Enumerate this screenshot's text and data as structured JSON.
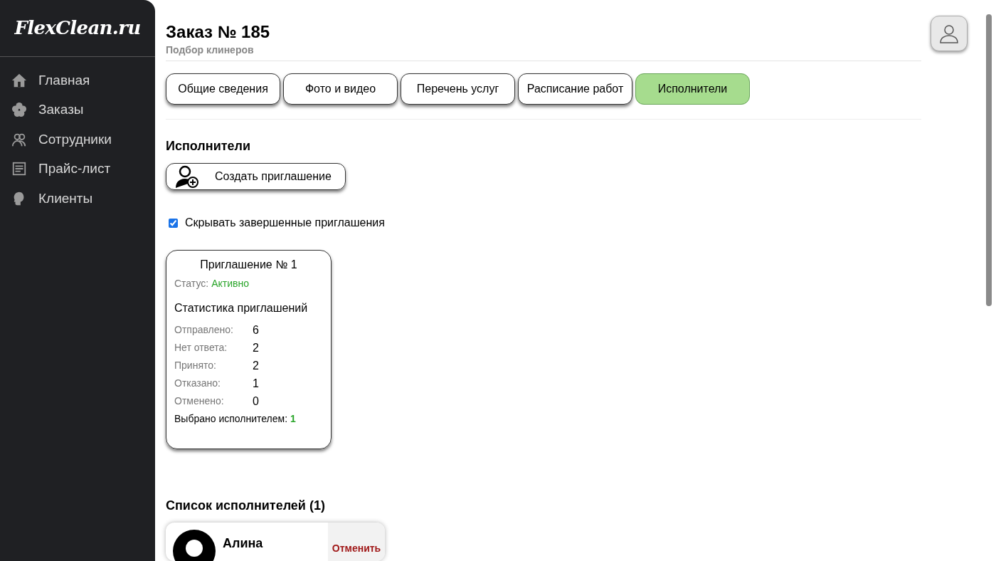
{
  "sidebar": {
    "logo": "FlexClean.ru",
    "items": [
      {
        "kind": "home",
        "label": "Главная",
        "selected": false
      },
      {
        "kind": "orders",
        "label": "Заказы",
        "selected": false
      },
      {
        "kind": "staff",
        "label": "Сотрудники",
        "selected": false
      },
      {
        "kind": "prices",
        "label": "Прайс-лист",
        "selected": false
      },
      {
        "kind": "clients",
        "label": "Клиенты",
        "selected": false
      }
    ]
  },
  "header": {
    "title": "Заказ № 185",
    "subtitle": "Подбор клинеров"
  },
  "tabs": [
    {
      "label": "Общие сведения",
      "selected": false
    },
    {
      "label": "Фото и видео",
      "selected": false
    },
    {
      "label": "Перечень услуг",
      "selected": false
    },
    {
      "label": "Расписание работ",
      "selected": false
    },
    {
      "label": "Исполнители",
      "selected": true
    }
  ],
  "section_title": "Исполнители",
  "create_button": "Создать приглашение",
  "hide_completed": {
    "label": "Скрывать завершенные приглашения",
    "checked": true
  },
  "invitation": {
    "title": "Приглашение № 1",
    "status_label": "Статус:",
    "status": "Активно",
    "stats_title": "Статистика приглашений",
    "stats": [
      {
        "label": "Отправлено:",
        "value": "6"
      },
      {
        "label": "Нет ответа:",
        "value": "2"
      },
      {
        "label": "Принято:",
        "value": "2"
      },
      {
        "label": "Отказано:",
        "value": "1"
      },
      {
        "label": "Отменено:",
        "value": "0"
      }
    ],
    "selected_label": "Выбрано исполнителем:",
    "selected_value": "1"
  },
  "performers_title": "Список исполнителей (1)",
  "performers": [
    {
      "name": "Алина",
      "action": "Отменить"
    }
  ]
}
